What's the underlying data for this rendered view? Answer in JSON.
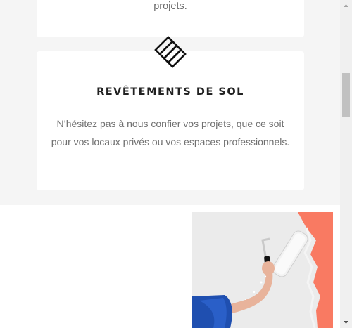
{
  "previous_card": {
    "text_tail": "projets."
  },
  "service_card": {
    "icon": "parquet-floor-icon",
    "title": "REVÊTEMENTS DE SOL",
    "description": "N’hésitez pas à nous confier vos projets, que ce soit pour vos locaux privés ou vos espaces professionnels."
  },
  "image": {
    "subject": "paint-roller-wall-photo"
  },
  "colors": {
    "section_background": "#f5f5f5",
    "card_background": "#ffffff",
    "title": "#222222",
    "body_text": "#707070",
    "accent_paint": "#f97a62"
  }
}
